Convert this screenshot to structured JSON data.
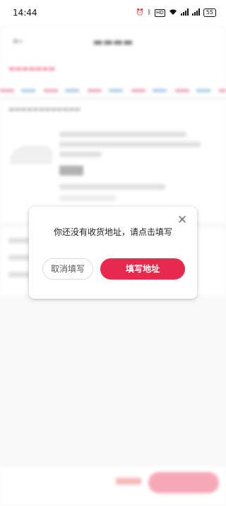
{
  "status_bar": {
    "time": "14:44",
    "battery": "55",
    "hd_badge": "HD"
  },
  "dialog": {
    "message": "你还没有收货地址，请点击填写",
    "cancel_label": "取消填写",
    "confirm_label": "填写地址",
    "accent_color": "#e8294e"
  }
}
